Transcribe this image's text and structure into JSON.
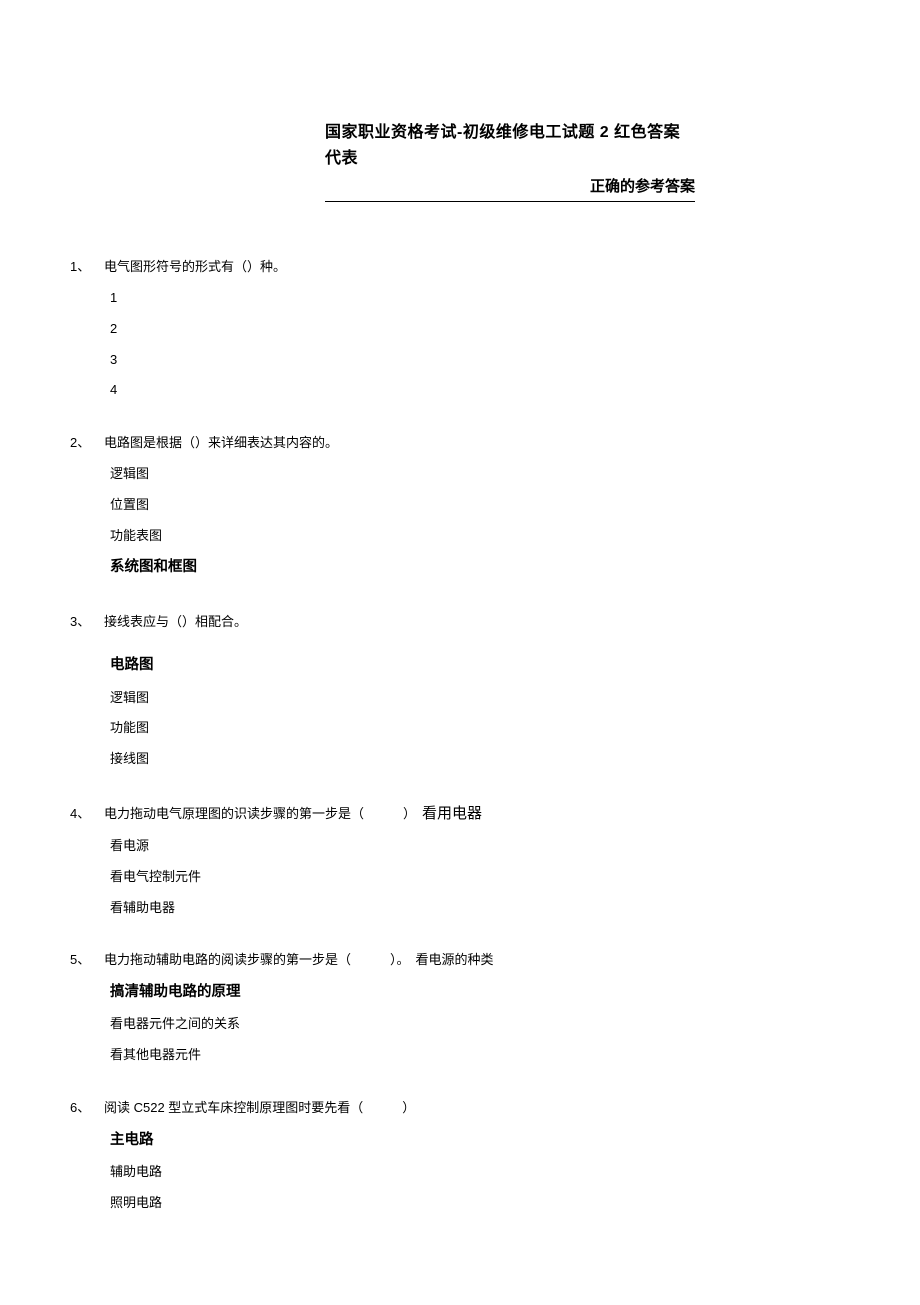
{
  "title": {
    "line1": "国家职业资格考试-初级维修电工试题 2 红色答案代表",
    "line2": "正确的参考答案"
  },
  "questions": [
    {
      "num": "1、",
      "text": "电气图形符号的形式有（）种。",
      "inline_option": "",
      "options": [
        {
          "text": "1",
          "bold": false
        },
        {
          "text": "2",
          "bold": false
        },
        {
          "text": "3",
          "bold": false
        },
        {
          "text": "4",
          "bold": false
        }
      ]
    },
    {
      "num": "2、",
      "text": "电路图是根据（）来详细表达其内容的。",
      "inline_option": "",
      "options": [
        {
          "text": "逻辑图",
          "bold": false
        },
        {
          "text": "位置图",
          "bold": false
        },
        {
          "text": "功能表图",
          "bold": false
        },
        {
          "text": "系统图和框图",
          "bold": true
        }
      ]
    },
    {
      "num": "3、",
      "text": "接线表应与（）相配合。",
      "inline_option": "",
      "options": [
        {
          "text": "电路图",
          "bold": true
        },
        {
          "text": "逻辑图",
          "bold": false
        },
        {
          "text": "功能图",
          "bold": false
        },
        {
          "text": "接线图",
          "bold": false
        }
      ]
    },
    {
      "num": "4、",
      "text": "电力拖动电气原理图的识读步骤的第一步是（　　　）",
      "inline_option": "看用电器",
      "options": [
        {
          "text": "看电源",
          "bold": false
        },
        {
          "text": "看电气控制元件",
          "bold": false
        },
        {
          "text": "看辅助电器",
          "bold": false
        }
      ]
    },
    {
      "num": "5、",
      "text": "电力拖动辅助电路的阅读步骤的第一步是（　　　）。",
      "inline_option": "看电源的种类",
      "options": [
        {
          "text": "搞清辅助电路的原理",
          "bold": true
        },
        {
          "text": "看电器元件之间的关系",
          "bold": false
        },
        {
          "text": "看其他电器元件",
          "bold": false
        }
      ]
    },
    {
      "num": "6、",
      "text": "阅读 C522 型立式车床控制原理图时要先看（　　　）",
      "inline_option": "",
      "options": [
        {
          "text": "主电路",
          "bold": true
        },
        {
          "text": "辅助电路",
          "bold": false
        },
        {
          "text": "照明电路",
          "bold": false
        }
      ]
    }
  ]
}
